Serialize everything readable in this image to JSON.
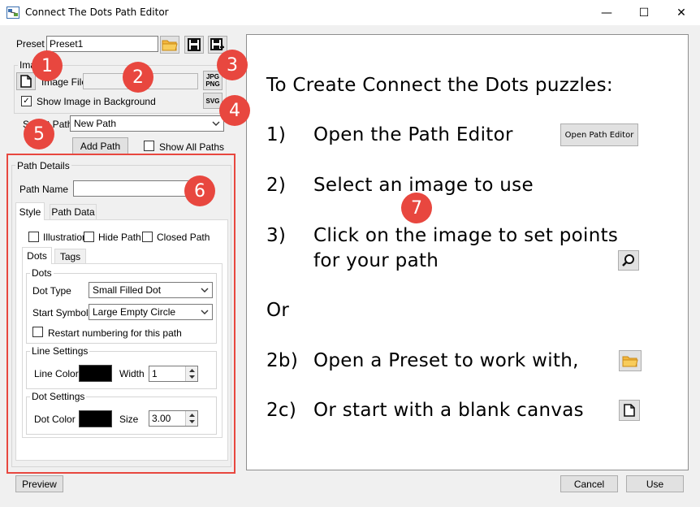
{
  "window": {
    "title": "Connect The Dots Path Editor",
    "minimize_glyph": "—",
    "maximize_glyph": "☐",
    "close_glyph": "✕"
  },
  "preset": {
    "label": "Preset",
    "value": "Preset1",
    "icons": [
      "open-folder-icon",
      "save-icon",
      "save-as-icon"
    ]
  },
  "image_group": {
    "title": "Image",
    "file_label": "Image File",
    "file_value": "",
    "show_background_label": "Show Image in Background",
    "show_background_checked": true,
    "jpg_png_label_1": "JPG",
    "jpg_png_label_2": "PNG",
    "svg_label": "SVG"
  },
  "select_path": {
    "label": "Select Path",
    "value": "New Path",
    "add_path_label": "Add Path",
    "show_all_label": "Show All Paths",
    "show_all_checked": false
  },
  "path_details": {
    "title": "Path Details",
    "name_label": "Path Name",
    "name_value": "",
    "tabs": [
      "Style",
      "Path Data"
    ],
    "selected_tab": "Style",
    "illustration_label": "Illustration",
    "hide_path_label": "Hide Path",
    "closed_path_label": "Closed Path",
    "subtabs": [
      "Dots",
      "Tags"
    ],
    "dots": {
      "title": "Dots",
      "dot_type_label": "Dot Type",
      "dot_type_value": "Small Filled Dot",
      "start_symbol_label": "Start Symbol",
      "start_symbol_value": "Large Empty Circle",
      "restart_label": "Restart numbering for this path"
    },
    "line_settings": {
      "title": "Line Settings",
      "color_label": "Line Color",
      "color": "#000000",
      "width_label": "Width",
      "width_value": "1"
    },
    "dot_settings": {
      "title": "Dot Settings",
      "color_label": "Dot Color",
      "color": "#000000",
      "size_label": "Size",
      "size_value": "3.00"
    }
  },
  "callouts": [
    "1",
    "2",
    "3",
    "4",
    "5",
    "6",
    "7"
  ],
  "callout_color": "#e8473f",
  "highlight_color": "#e8473f",
  "instructions": {
    "heading": "To Create Connect the Dots puzzles:",
    "step1_num": "1)",
    "step1_text": "Open the Path Editor",
    "step1_button": "Open Path Editor",
    "step2_num": "2)",
    "step2_text": "Select an image to use",
    "step3_num": "3)",
    "step3_line1": "Click on the image to set points",
    "step3_line2": "for your path",
    "or": "Or",
    "step2b_num": "2b)",
    "step2b_text": "Open a Preset to work with,",
    "step2c_num": "2c)",
    "step2c_text": "Or start with a blank canvas"
  },
  "footer": {
    "preview": "Preview",
    "cancel": "Cancel",
    "use": "Use"
  }
}
